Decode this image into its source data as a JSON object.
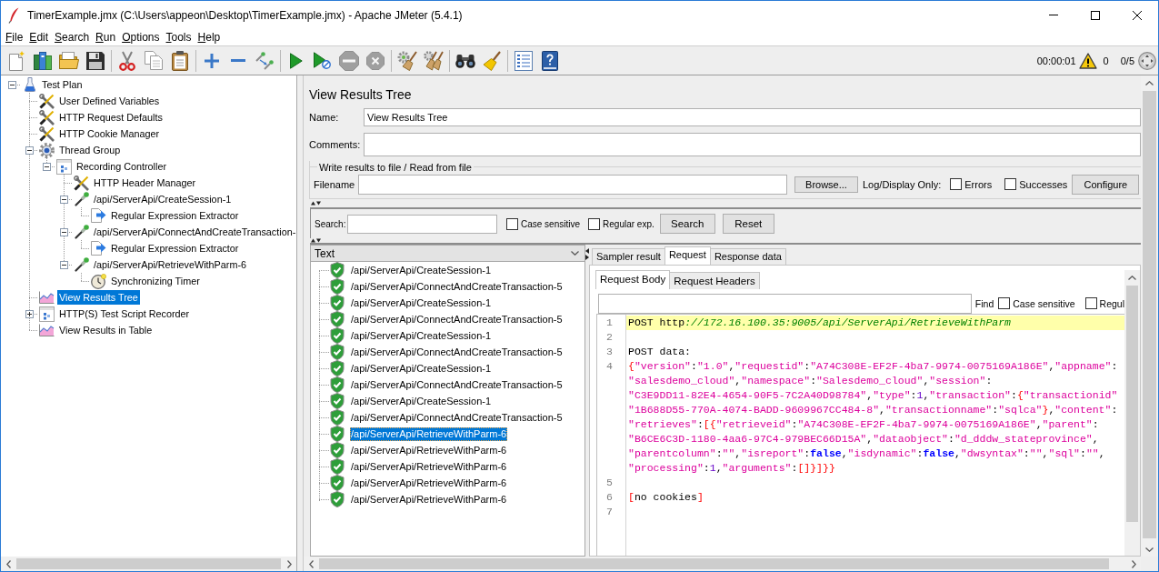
{
  "window": {
    "title": "TimerExample.jmx (C:\\Users\\appeon\\Desktop\\TimerExample.jmx) - Apache JMeter (5.4.1)"
  },
  "menu": [
    "File",
    "Edit",
    "Search",
    "Run",
    "Options",
    "Tools",
    "Help"
  ],
  "toolbar": {
    "groups": [
      {
        "buttons": [
          {
            "kind": "new",
            "disabled": false
          },
          {
            "kind": "templates",
            "disabled": false
          },
          {
            "kind": "open",
            "disabled": false
          },
          {
            "kind": "save",
            "disabled": false
          }
        ]
      },
      {
        "buttons": [
          {
            "kind": "cut",
            "disabled": false
          },
          {
            "kind": "copy",
            "disabled": false
          },
          {
            "kind": "paste",
            "disabled": false
          }
        ]
      },
      {
        "buttons": [
          {
            "kind": "expand",
            "disabled": false
          },
          {
            "kind": "collapse",
            "disabled": false
          },
          {
            "kind": "toggle",
            "disabled": false
          }
        ]
      },
      {
        "buttons": [
          {
            "kind": "start",
            "disabled": false
          },
          {
            "kind": "nopause",
            "disabled": false
          },
          {
            "kind": "stop",
            "disabled": true
          },
          {
            "kind": "shutdown",
            "disabled": true
          }
        ]
      },
      {
        "buttons": [
          {
            "kind": "clear",
            "disabled": false
          },
          {
            "kind": "clearall",
            "disabled": false
          }
        ]
      },
      {
        "buttons": [
          {
            "kind": "search",
            "disabled": false
          },
          {
            "kind": "reset",
            "disabled": false
          }
        ]
      },
      {
        "buttons": [
          {
            "kind": "functions",
            "disabled": false
          },
          {
            "kind": "help",
            "disabled": false
          }
        ]
      }
    ],
    "elapsed": "00:00:01",
    "errors": "0",
    "threads": "0/5"
  },
  "test_tree": [
    {
      "label": "Test Plan",
      "kind": "plan",
      "expanded": true,
      "selected": false,
      "children": [
        {
          "label": "User Defined Variables",
          "kind": "config",
          "selected": false
        },
        {
          "label": "HTTP Request Defaults",
          "kind": "config",
          "selected": false
        },
        {
          "label": "HTTP Cookie Manager",
          "kind": "config",
          "selected": false
        },
        {
          "label": "Thread Group",
          "kind": "threads",
          "expanded": true,
          "selected": false,
          "children": [
            {
              "label": "Recording Controller",
              "kind": "controller",
              "expanded": true,
              "selected": false,
              "children": [
                {
                  "label": "HTTP Header Manager",
                  "kind": "config",
                  "selected": false
                },
                {
                  "label": "/api/ServerApi/CreateSession-1",
                  "kind": "sampler",
                  "expanded": true,
                  "selected": false,
                  "children": [
                    {
                      "label": "Regular Expression Extractor",
                      "kind": "extractor",
                      "selected": false
                    }
                  ]
                },
                {
                  "label": "/api/ServerApi/ConnectAndCreateTransaction-",
                  "kind": "sampler",
                  "expanded": true,
                  "selected": false,
                  "children": [
                    {
                      "label": "Regular Expression Extractor",
                      "kind": "extractor",
                      "selected": false
                    }
                  ]
                },
                {
                  "label": "/api/ServerApi/RetrieveWithParm-6",
                  "kind": "sampler",
                  "expanded": true,
                  "selected": false,
                  "children": [
                    {
                      "label": "Synchronizing Timer",
                      "kind": "timer",
                      "selected": false
                    }
                  ]
                }
              ]
            }
          ]
        },
        {
          "label": "View Results Tree",
          "kind": "listener",
          "selected": true
        },
        {
          "label": "HTTP(S) Test Script Recorder",
          "kind": "controller",
          "expanded": false,
          "selected": false
        },
        {
          "label": "View Results in Table",
          "kind": "listener",
          "selected": false
        }
      ]
    }
  ],
  "editor": {
    "title": "View Results Tree",
    "name": {
      "label": "Name:",
      "value": "View Results Tree"
    },
    "comments": {
      "label": "Comments:"
    },
    "file_group": {
      "title": "Write results to file / Read from file",
      "filename_label": "Filename",
      "browse_button": "Browse...",
      "log_label": "Log/Display Only:",
      "options": [
        {
          "label": "Errors",
          "checked": false
        },
        {
          "label": "Successes",
          "checked": false
        }
      ],
      "configure_button": "Configure"
    },
    "search": {
      "label": "Search:",
      "options": [
        {
          "label": "Case sensitive",
          "checked": false
        },
        {
          "label": "Regular exp.",
          "checked": false
        }
      ],
      "buttons": [
        "Search",
        "Reset"
      ]
    }
  },
  "results": {
    "renderer": "Text",
    "items": [
      {
        "label": "/api/ServerApi/CreateSession-1",
        "success": true,
        "selected": false
      },
      {
        "label": "/api/ServerApi/ConnectAndCreateTransaction-5",
        "success": true,
        "selected": false
      },
      {
        "label": "/api/ServerApi/CreateSession-1",
        "success": true,
        "selected": false
      },
      {
        "label": "/api/ServerApi/ConnectAndCreateTransaction-5",
        "success": true,
        "selected": false
      },
      {
        "label": "/api/ServerApi/CreateSession-1",
        "success": true,
        "selected": false
      },
      {
        "label": "/api/ServerApi/ConnectAndCreateTransaction-5",
        "success": true,
        "selected": false
      },
      {
        "label": "/api/ServerApi/CreateSession-1",
        "success": true,
        "selected": false
      },
      {
        "label": "/api/ServerApi/ConnectAndCreateTransaction-5",
        "success": true,
        "selected": false
      },
      {
        "label": "/api/ServerApi/CreateSession-1",
        "success": true,
        "selected": false
      },
      {
        "label": "/api/ServerApi/ConnectAndCreateTransaction-5",
        "success": true,
        "selected": false
      },
      {
        "label": "/api/ServerApi/RetrieveWithParm-6",
        "success": true,
        "selected": true
      },
      {
        "label": "/api/ServerApi/RetrieveWithParm-6",
        "success": true,
        "selected": false
      },
      {
        "label": "/api/ServerApi/RetrieveWithParm-6",
        "success": true,
        "selected": false
      },
      {
        "label": "/api/ServerApi/RetrieveWithParm-6",
        "success": true,
        "selected": false
      },
      {
        "label": "/api/ServerApi/RetrieveWithParm-6",
        "success": true,
        "selected": false
      }
    ],
    "tabs": [
      {
        "label": "Sampler result",
        "selected": false
      },
      {
        "label": "Request",
        "selected": true
      },
      {
        "label": "Response data",
        "selected": false
      }
    ],
    "request_view": {
      "tabs": [
        {
          "label": "Request Body",
          "selected": true
        },
        {
          "label": "Request Headers",
          "selected": false
        }
      ],
      "find": {
        "label": "Find",
        "options": [
          {
            "label": "Case sensitive",
            "checked": false
          },
          {
            "label": "Regul",
            "checked": false
          }
        ]
      },
      "lines": [
        {
          "number": "1",
          "highlighted": true,
          "rows": [
            {
              "tokens": [
                {
                  "kind": "plain",
                  "text": "POST http"
                },
                {
                  "kind": "comment",
                  "text": "://172.16.100.35:9005/api/ServerApi/RetrieveWithParm"
                }
              ]
            }
          ]
        },
        {
          "number": "2",
          "highlighted": false
        },
        {
          "number": "3",
          "highlighted": false,
          "rows": [
            {
              "tokens": [
                {
                  "kind": "plain",
                  "text": "POST data:"
                }
              ]
            }
          ]
        },
        {
          "number": "4",
          "highlighted": false,
          "rows": [
            {
              "tokens": [
                {
                  "kind": "bracket",
                  "text": "{"
                },
                {
                  "kind": "string",
                  "text": "\"version\""
                },
                {
                  "kind": "plain",
                  "text": ":"
                },
                {
                  "kind": "string",
                  "text": "\"1.0\""
                },
                {
                  "kind": "plain",
                  "text": ","
                },
                {
                  "kind": "string",
                  "text": "\"requestid\""
                },
                {
                  "kind": "plain",
                  "text": ":"
                },
                {
                  "kind": "string",
                  "text": "\"A74C308E-EF2F-4ba7-9974-0075169A186E\""
                },
                {
                  "kind": "plain",
                  "text": ","
                },
                {
                  "kind": "string",
                  "text": "\"appname\""
                },
                {
                  "kind": "plain",
                  "text": ":"
                }
              ]
            },
            {
              "tokens": [
                {
                  "kind": "string",
                  "text": "\"salesdemo_cloud\""
                },
                {
                  "kind": "plain",
                  "text": ","
                },
                {
                  "kind": "string",
                  "text": "\"namespace\""
                },
                {
                  "kind": "plain",
                  "text": ":"
                },
                {
                  "kind": "string",
                  "text": "\"Salesdemo_cloud\""
                },
                {
                  "kind": "plain",
                  "text": ","
                },
                {
                  "kind": "string",
                  "text": "\"session\""
                },
                {
                  "kind": "plain",
                  "text": ":"
                }
              ]
            },
            {
              "tokens": [
                {
                  "kind": "string",
                  "text": "\"C3E9DD11-82E4-4654-90F5-7C2A40D98784\""
                },
                {
                  "kind": "plain",
                  "text": ","
                },
                {
                  "kind": "string",
                  "text": "\"type\""
                },
                {
                  "kind": "plain",
                  "text": ":"
                },
                {
                  "kind": "number",
                  "text": "1"
                },
                {
                  "kind": "plain",
                  "text": ","
                },
                {
                  "kind": "string",
                  "text": "\"transaction\""
                },
                {
                  "kind": "plain",
                  "text": ":"
                },
                {
                  "kind": "bracket",
                  "text": "{"
                },
                {
                  "kind": "string",
                  "text": "\"transactionid\""
                }
              ]
            },
            {
              "tokens": [
                {
                  "kind": "string",
                  "text": "\"1B688D55-770A-4074-BADD-9609967CC484-8\""
                },
                {
                  "kind": "plain",
                  "text": ","
                },
                {
                  "kind": "string",
                  "text": "\"transactionname\""
                },
                {
                  "kind": "plain",
                  "text": ":"
                },
                {
                  "kind": "string",
                  "text": "\"sqlca\""
                },
                {
                  "kind": "bracket",
                  "text": "}"
                },
                {
                  "kind": "plain",
                  "text": ","
                },
                {
                  "kind": "string",
                  "text": "\"content\""
                },
                {
                  "kind": "plain",
                  "text": ":"
                }
              ]
            },
            {
              "tokens": [
                {
                  "kind": "string",
                  "text": "\"retrieves\""
                },
                {
                  "kind": "plain",
                  "text": ":"
                },
                {
                  "kind": "bracket",
                  "text": "[{"
                },
                {
                  "kind": "string",
                  "text": "\"retrieveid\""
                },
                {
                  "kind": "plain",
                  "text": ":"
                },
                {
                  "kind": "string",
                  "text": "\"A74C308E-EF2F-4ba7-9974-0075169A186E\""
                },
                {
                  "kind": "plain",
                  "text": ","
                },
                {
                  "kind": "string",
                  "text": "\"parent\""
                },
                {
                  "kind": "plain",
                  "text": ":"
                }
              ]
            },
            {
              "tokens": [
                {
                  "kind": "string",
                  "text": "\"B6CE6C3D-1180-4aa6-97C4-979BEC66D15A\""
                },
                {
                  "kind": "plain",
                  "text": ","
                },
                {
                  "kind": "string",
                  "text": "\"dataobject\""
                },
                {
                  "kind": "plain",
                  "text": ":"
                },
                {
                  "kind": "string",
                  "text": "\"d_dddw_stateprovince\""
                },
                {
                  "kind": "plain",
                  "text": ","
                }
              ]
            },
            {
              "tokens": [
                {
                  "kind": "string",
                  "text": "\"parentcolumn\""
                },
                {
                  "kind": "plain",
                  "text": ":"
                },
                {
                  "kind": "string",
                  "text": "\"\""
                },
                {
                  "kind": "plain",
                  "text": ","
                },
                {
                  "kind": "string",
                  "text": "\"isreport\""
                },
                {
                  "kind": "plain",
                  "text": ":"
                },
                {
                  "kind": "keyword",
                  "text": "false"
                },
                {
                  "kind": "plain",
                  "text": ","
                },
                {
                  "kind": "string",
                  "text": "\"isdynamic\""
                },
                {
                  "kind": "plain",
                  "text": ":"
                },
                {
                  "kind": "keyword",
                  "text": "false"
                },
                {
                  "kind": "plain",
                  "text": ","
                },
                {
                  "kind": "string",
                  "text": "\"dwsyntax\""
                },
                {
                  "kind": "plain",
                  "text": ":"
                },
                {
                  "kind": "string",
                  "text": "\"\""
                },
                {
                  "kind": "plain",
                  "text": ","
                },
                {
                  "kind": "string",
                  "text": "\"sql\""
                },
                {
                  "kind": "plain",
                  "text": ":"
                },
                {
                  "kind": "string",
                  "text": "\"\""
                },
                {
                  "kind": "plain",
                  "text": ","
                }
              ]
            },
            {
              "tokens": [
                {
                  "kind": "string",
                  "text": "\"processing\""
                },
                {
                  "kind": "plain",
                  "text": ":"
                },
                {
                  "kind": "number",
                  "text": "1"
                },
                {
                  "kind": "plain",
                  "text": ","
                },
                {
                  "kind": "string",
                  "text": "\"arguments\""
                },
                {
                  "kind": "plain",
                  "text": ":"
                },
                {
                  "kind": "bracket",
                  "text": "[]}]}}"
                }
              ]
            }
          ]
        },
        {
          "number": "5",
          "highlighted": false
        },
        {
          "number": "6",
          "highlighted": false,
          "rows": [
            {
              "tokens": [
                {
                  "kind": "bracket",
                  "text": "["
                },
                {
                  "kind": "plain",
                  "text": "no cookies"
                },
                {
                  "kind": "bracket",
                  "text": "]"
                }
              ]
            }
          ]
        },
        {
          "number": "7",
          "highlighted": false
        }
      ]
    }
  }
}
